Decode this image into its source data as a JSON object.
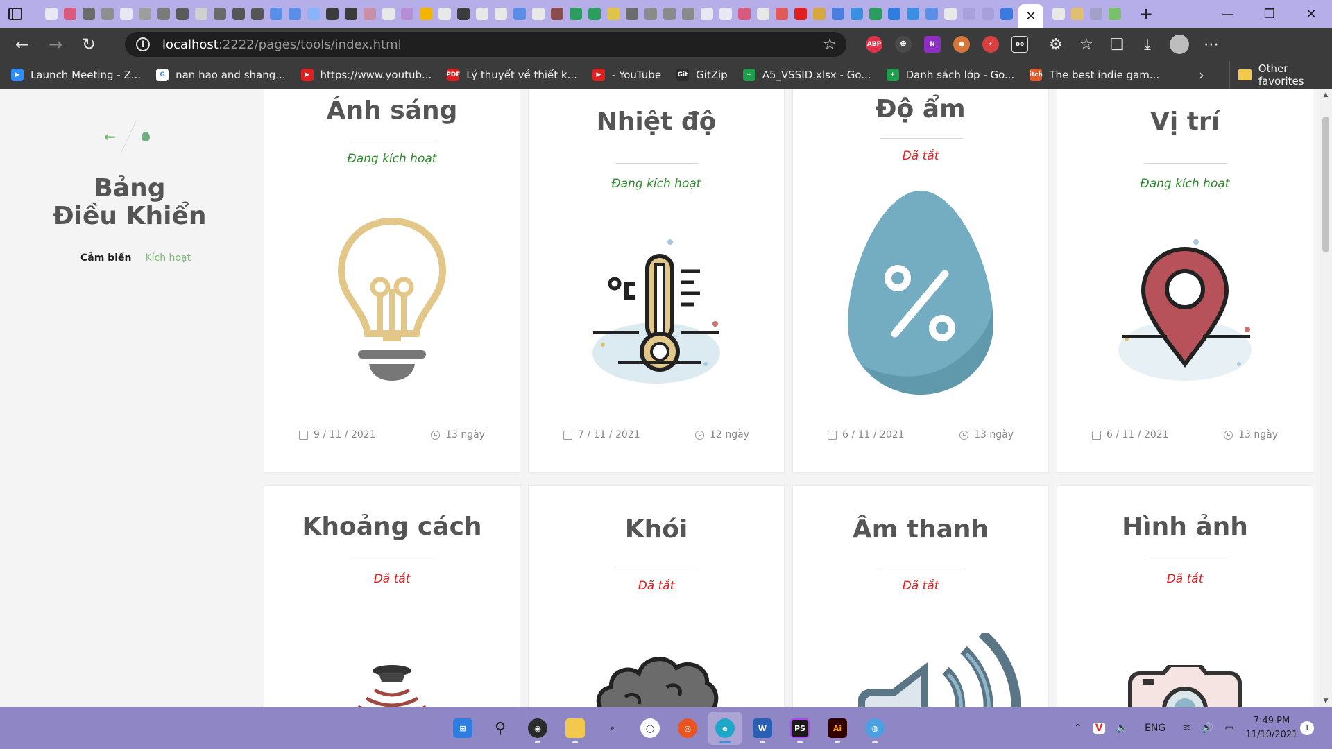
{
  "browser": {
    "url_host": "localhost",
    "url_rest": ":2222/pages/tools/index.html",
    "tab_close": "✕",
    "new_tab": "+",
    "tab_favicon_colors": [
      "#e8e8f5",
      "#d85a7f",
      "#6c6c6c",
      "#8f8f8f",
      "#e8e8f5",
      "#9e9e9e",
      "#7a7a7a",
      "#5a5a5a",
      "#d0d0d0",
      "#6a6a6a",
      "#555555",
      "#555555",
      "#5b8ee6",
      "#5b8ee6",
      "#8ab4f8",
      "#3b3b3b",
      "#3b3b3b",
      "#c98fa6",
      "#e8e8e8",
      "#b48fd8",
      "#f4b400",
      "#e8e8e8",
      "#3b3b3b",
      "#e8e8e8",
      "#e8e8e8",
      "#5b8ee6",
      "#e8e8e8",
      "#8a4c4c",
      "#2a9d5f",
      "#2a9d5f",
      "#e0c34a",
      "#6c6c6c",
      "#8a8a8a",
      "#8a8a8a",
      "#8a8a8a",
      "#e8e8f5",
      "#e8e8f5",
      "#d85a7f",
      "#e8e8e8",
      "#e05a5a",
      "#e02020",
      "#d8a840",
      "#4a7fe0",
      "#3b8fe0",
      "#2a9d5f",
      "#2f7de0",
      "#3b8fe0",
      "#5b8ee6",
      "#e8e8e8",
      "#a8a0d8",
      "#a8a0d8",
      "#3b7be0"
    ],
    "right_tab_colors": [
      "#e8e8e8",
      "#e0c070",
      "#a0a0c8",
      "#7abf6a"
    ]
  },
  "bookmarks": [
    {
      "label": "Launch Meeting - Z...",
      "color": "#2d8cff",
      "glyph": "▶"
    },
    {
      "label": "nan hao and shang...",
      "color": "#ffffff",
      "glyph": "G"
    },
    {
      "label": "https://www.youtub...",
      "color": "#e02020",
      "glyph": "▶"
    },
    {
      "label": "Lý thuyết về thiết k...",
      "color": "#d82020",
      "glyph": "PDF"
    },
    {
      "label": "- YouTube",
      "color": "#e02020",
      "glyph": "▶"
    },
    {
      "label": "GitZip",
      "color": "#2b2b2b",
      "glyph": "Git"
    },
    {
      "label": "A5_VSSID.xlsx - Go...",
      "color": "#1e9e4a",
      "glyph": "+"
    },
    {
      "label": "Danh sách lớp - Go...",
      "color": "#1e9e4a",
      "glyph": "+"
    },
    {
      "label": "The best indie gam...",
      "color": "#e05a2a",
      "glyph": "itch"
    }
  ],
  "bookmarks_other": "Other favorites",
  "sidebar": {
    "brand_line1": "Bảng",
    "brand_line2": "Điều Khiển",
    "nav_sensors": "Cảm biến",
    "nav_active": "Kích hoạt"
  },
  "cards": [
    {
      "title": "Ánh sáng",
      "status": "Đang kích hoạt",
      "status_on": true,
      "date": "9 / 11 / 2021",
      "days": "13 ngày",
      "icon": "lightbulb-icon"
    },
    {
      "title": "Nhiệt độ",
      "status": "Đang kích hoạt",
      "status_on": true,
      "date": "7 / 11 / 2021",
      "days": "12 ngày",
      "icon": "thermometer-icon"
    },
    {
      "title": "Độ ẩm",
      "status": "Đã tắt",
      "status_on": false,
      "date": "6 / 11 / 2021",
      "days": "13 ngày",
      "icon": "humidity-drop-icon"
    },
    {
      "title": "Vị trí",
      "status": "Đang kích hoạt",
      "status_on": true,
      "date": "6 / 11 / 2021",
      "days": "13 ngày",
      "icon": "location-pin-icon"
    },
    {
      "title": "Khoảng cách",
      "status": "Đã tắt",
      "status_on": false,
      "icon": "distance-sensor-icon"
    },
    {
      "title": "Khói",
      "status": "Đã tắt",
      "status_on": false,
      "icon": "smoke-cloud-icon"
    },
    {
      "title": "Âm thanh",
      "status": "Đã tắt",
      "status_on": false,
      "icon": "speaker-sound-icon"
    },
    {
      "title": "Hình ảnh",
      "status": "Đã tắt",
      "status_on": false,
      "icon": "camera-icon"
    }
  ],
  "colors": {
    "status_on": "#2e8b2e",
    "status_off": "#e02020",
    "accent_green": "#7dbb7a",
    "tabstrip": "#b5aee9",
    "taskbar": "#8f86c6"
  },
  "taskbar": {
    "lang": "ENG",
    "time": "7:49 PM",
    "date": "11/10/2021",
    "notifications": "1"
  }
}
